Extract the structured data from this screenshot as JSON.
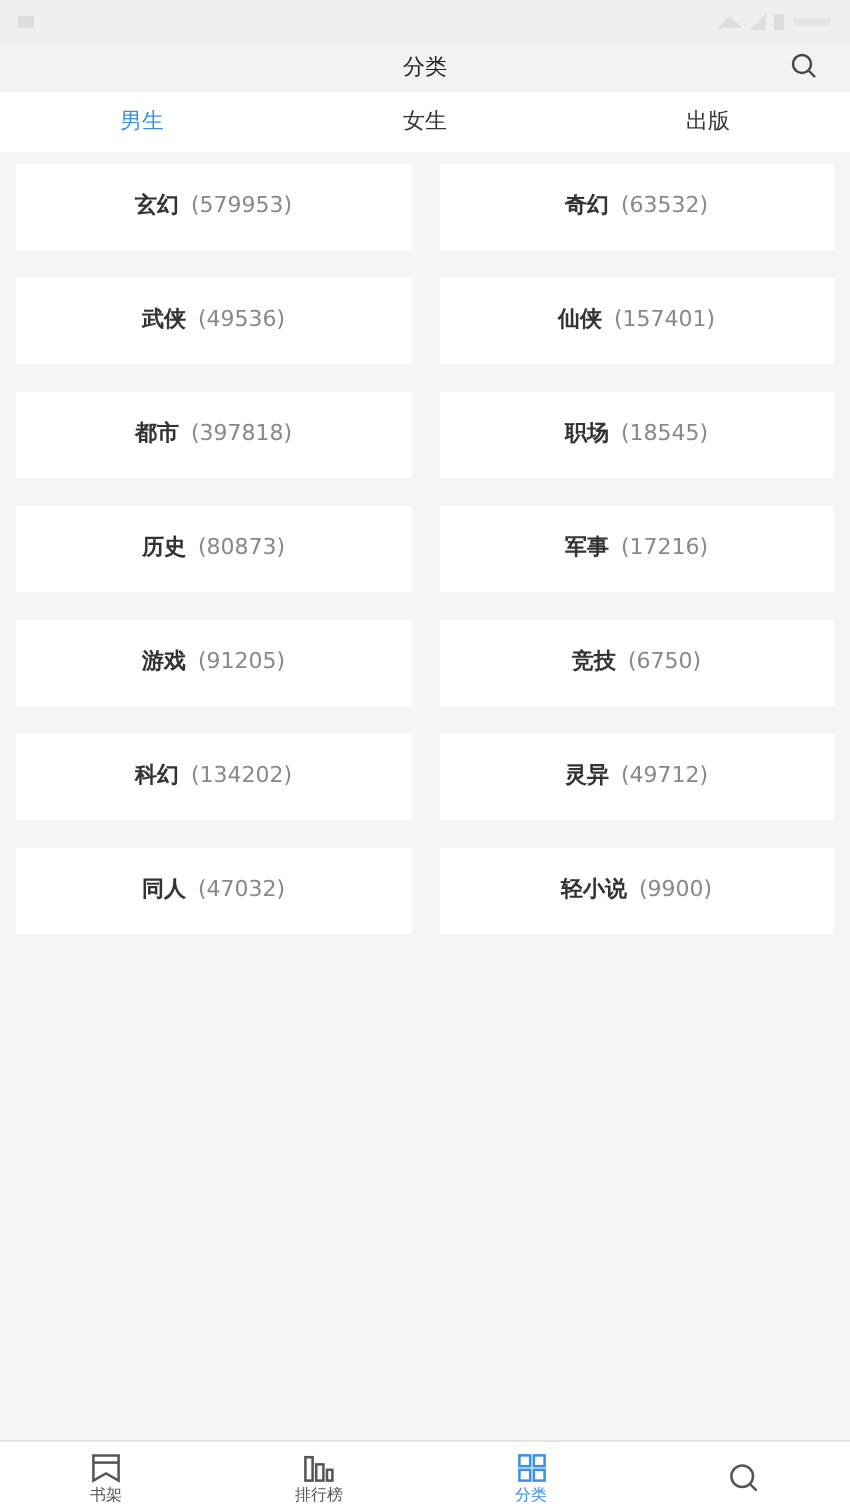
{
  "header": {
    "title": "分类"
  },
  "tabs": [
    {
      "label": "男生",
      "selected": true
    },
    {
      "label": "女生",
      "selected": false
    },
    {
      "label": "出版",
      "selected": false
    }
  ],
  "categories": [
    {
      "name": "玄幻",
      "count": "(579953)"
    },
    {
      "name": "奇幻",
      "count": "(63532)"
    },
    {
      "name": "武侠",
      "count": "(49536)"
    },
    {
      "name": "仙侠",
      "count": "(157401)"
    },
    {
      "name": "都市",
      "count": "(397818)"
    },
    {
      "name": "职场",
      "count": "(18545)"
    },
    {
      "name": "历史",
      "count": "(80873)"
    },
    {
      "name": "军事",
      "count": "(17216)"
    },
    {
      "name": "游戏",
      "count": "(91205)"
    },
    {
      "name": "竞技",
      "count": "(6750)"
    },
    {
      "name": "科幻",
      "count": "(134202)"
    },
    {
      "name": "灵异",
      "count": "(49712)"
    },
    {
      "name": "同人",
      "count": "(47032)"
    },
    {
      "name": "轻小说",
      "count": "(9900)"
    }
  ],
  "bottom_nav": [
    {
      "kind": "shelf",
      "label": "书架",
      "selected": false
    },
    {
      "kind": "ranking",
      "label": "排行榜",
      "selected": false
    },
    {
      "kind": "category",
      "label": "分类",
      "selected": true
    },
    {
      "kind": "search",
      "selected": false
    }
  ]
}
